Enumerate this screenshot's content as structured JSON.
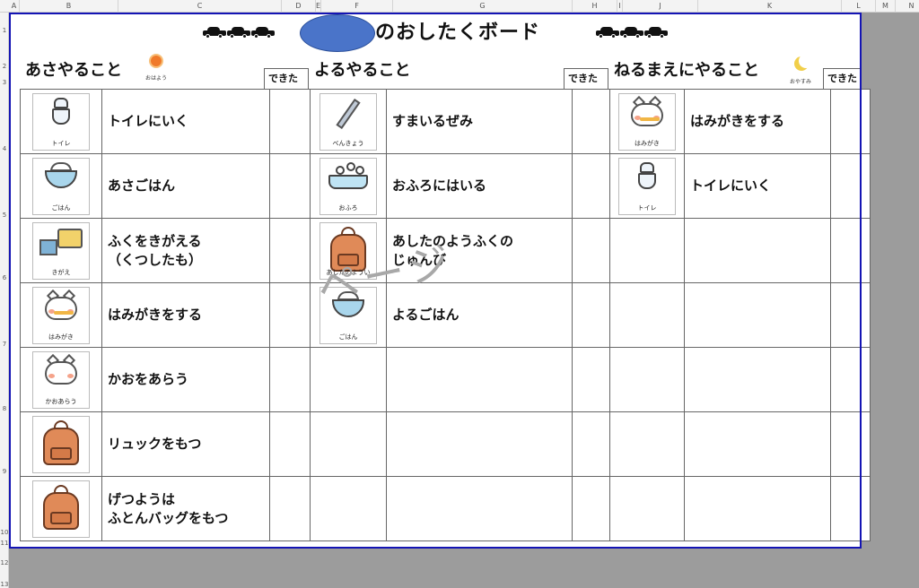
{
  "spreadsheet": {
    "columns": [
      "A",
      "B",
      "C",
      "D",
      "E",
      "F",
      "G",
      "H",
      "I",
      "J",
      "K",
      "L",
      "M",
      "N"
    ],
    "rows": [
      "1",
      "2",
      "3",
      "4",
      "5",
      "6",
      "7",
      "8",
      "9",
      "10",
      "11",
      "12",
      "13"
    ]
  },
  "board": {
    "title": "のおしたくボード",
    "name_oval_color": "#4a74c9",
    "page_border_color": "#1414b4",
    "watermark": "ページ",
    "done_label": "できた"
  },
  "sections": [
    {
      "title": "あさやること",
      "deco_label": "おはよう",
      "deco_icon": "sun-icon",
      "tasks": [
        {
          "text": "トイレにいく",
          "icon": "toilet-icon",
          "icon_label": "トイレ"
        },
        {
          "text": "あさごはん",
          "icon": "rice-bowl-icon",
          "icon_label": "ごはん"
        },
        {
          "text": "ふくをきがえる\n（くつしたも）",
          "icon": "clothes-icon",
          "icon_label": "きがえ"
        },
        {
          "text": "はみがきをする",
          "icon": "toothbrush-cat-icon",
          "icon_label": "はみがき"
        },
        {
          "text": "かおをあらう",
          "icon": "face-wash-cat-icon",
          "icon_label": "かおあらう"
        },
        {
          "text": "リュックをもつ",
          "icon": "backpack-icon",
          "icon_label": ""
        },
        {
          "text": "げつようは\nふとんバッグをもつ",
          "icon": "backpack-icon",
          "icon_label": ""
        }
      ]
    },
    {
      "title": "よるやること",
      "tasks": [
        {
          "text": "すまいるぜみ",
          "icon": "pencil-icon",
          "icon_label": "べんきょう"
        },
        {
          "text": "おふろにはいる",
          "icon": "bath-icon",
          "icon_label": "おふろ"
        },
        {
          "text": "あしたのようふくの\nじゅんび",
          "icon": "backpack-icon",
          "icon_label": "あしたのようい"
        },
        {
          "text": "よるごはん",
          "icon": "rice-bowl-icon",
          "icon_label": "ごはん"
        }
      ]
    },
    {
      "title": "ねるまえにやること",
      "deco_label": "おやすみ",
      "deco_icon": "moon-icon",
      "tasks": [
        {
          "text": "はみがきをする",
          "icon": "toothbrush-cat-icon",
          "icon_label": "はみがき"
        },
        {
          "text": "トイレにいく",
          "icon": "toilet-icon",
          "icon_label": "トイレ"
        }
      ]
    }
  ]
}
